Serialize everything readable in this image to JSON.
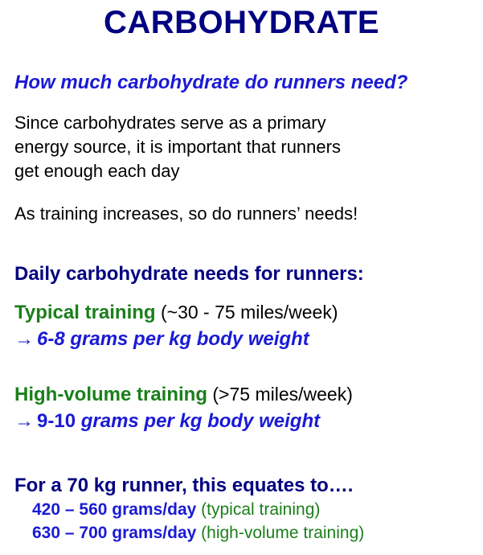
{
  "title": "CARBOHYDRATE",
  "question": "How much carbohydrate do runners need?",
  "paragraph1": [
    "Since carbohydrates serve as a primary",
    "energy source, it is important that runners",
    "get enough each day"
  ],
  "paragraph2": "As training increases, so do runners’ needs!",
  "needs_heading": "Daily carbohydrate needs for runners:",
  "typical": {
    "label": "Typical training",
    "range": " (~30 - 75 miles/week)",
    "arrow": "→",
    "amount": "6-8 grams per kg body weight"
  },
  "high_volume": {
    "label": "High-volume training",
    "range": " (>75 miles/week)",
    "arrow": "→",
    "amount_value": "9-10",
    "amount_unit": "grams per kg body weight"
  },
  "example_heading": "For a 70 kg runner, this equates to….",
  "examples": [
    {
      "amount": "420 – 560 grams/day",
      "note": " (typical training)"
    },
    {
      "amount": "630 – 700 grams/day",
      "note": " (high-volume training)"
    }
  ],
  "colors": {
    "navy": "#000080",
    "blue": "#1a1ad6",
    "green": "#1a7f1a",
    "text": "#000000"
  }
}
